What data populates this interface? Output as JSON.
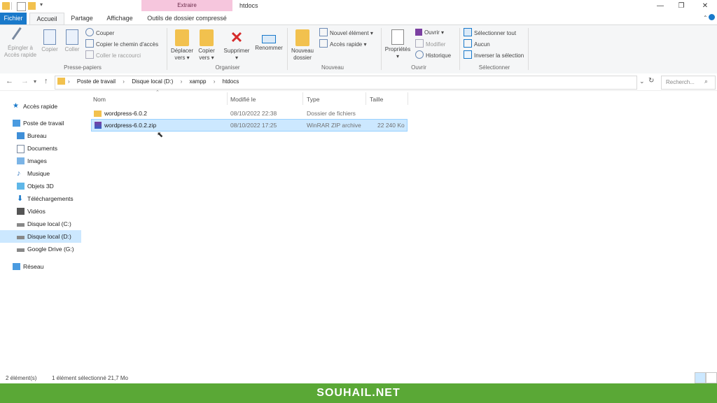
{
  "window": {
    "title": "htdocs",
    "context_tab_band": "Extraire",
    "minimize": "—",
    "maximize": "❐",
    "close": "✕"
  },
  "tabs": {
    "fichier": "Fichier",
    "accueil": "Accueil",
    "partage": "Partage",
    "affichage": "Affichage",
    "outils": "Outils de dossier compressé"
  },
  "ribbon": {
    "presse_papiers": {
      "label": "Presse-papiers",
      "epingler": "Épingler à",
      "epingler2": "Accès rapide",
      "copier": "Copier",
      "coller": "Coller",
      "couper": "Couper",
      "copier_chemin": "Copier le chemin d'accès",
      "coller_raccourci": "Coller le raccourci"
    },
    "organiser": {
      "label": "Organiser",
      "deplacer": "Déplacer",
      "deplacer2": "vers",
      "copier": "Copier",
      "copier2": "vers",
      "supprimer": "Supprimer",
      "renommer": "Renommer"
    },
    "nouveau": {
      "label": "Nouveau",
      "nouveau_dossier": "Nouveau",
      "nouveau_dossier2": "dossier",
      "nouvel_element": "Nouvel élément",
      "acces_rapide": "Accès rapide"
    },
    "ouvrir": {
      "label": "Ouvrir",
      "proprietes": "Propriétés",
      "ouvrir": "Ouvrir",
      "modifier": "Modifier",
      "historique": "Historique"
    },
    "selectionner": {
      "label": "Sélectionner",
      "tout": "Sélectionner tout",
      "aucun": "Aucun",
      "inverser": "Inverser la sélection"
    }
  },
  "address": {
    "path": [
      "Poste de travail",
      "Disque local (D:)",
      "xampp",
      "htdocs"
    ],
    "search_placeholder": "Recherch..."
  },
  "navpane": {
    "acces_rapide": "Accès rapide",
    "poste": "Poste de travail",
    "bureau": "Bureau",
    "documents": "Documents",
    "images": "Images",
    "musique": "Musique",
    "objets3d": "Objets 3D",
    "telechargements": "Téléchargements",
    "videos": "Vidéos",
    "disque_c": "Disque local (C:)",
    "disque_d": "Disque local (D:)",
    "google": "Google Drive (G:)",
    "reseau": "Réseau"
  },
  "columns": {
    "nom": "Nom",
    "modifie": "Modifié le",
    "type": "Type",
    "taille": "Taille"
  },
  "files": [
    {
      "name": "wordpress-6.0.2",
      "date": "08/10/2022 22:38",
      "type": "Dossier de fichiers",
      "size": ""
    },
    {
      "name": "wordpress-6.0.2.zip",
      "date": "08/10/2022 17:25",
      "type": "WinRAR ZIP archive",
      "size": "22 240 Ko"
    }
  ],
  "status": {
    "count": "2 élément(s)",
    "selection": "1 élément sélectionné  21,7 Mo"
  },
  "banner": "SOUHAIL.NET",
  "colors": {
    "accent": "#1979ca",
    "selection": "#cce8ff",
    "banner": "#5aa836",
    "context_band": "#f6c6dd"
  }
}
